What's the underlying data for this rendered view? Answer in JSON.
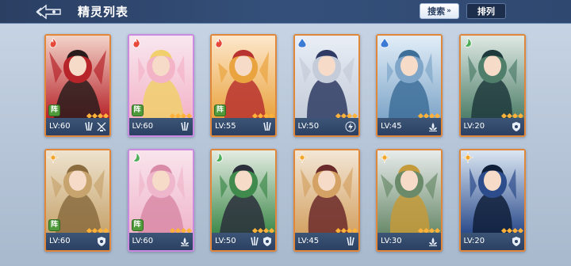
{
  "header": {
    "title": "精灵列表",
    "search_label": "搜索",
    "sort_label": "排列"
  },
  "colors": {
    "header_bg": "#2b3f63",
    "card_border_orange": "#e0873a",
    "card_border_purple": "#c98ae0",
    "card_footer": "#2f4568",
    "formation_badge": "#4f9a3a"
  },
  "cards": [
    {
      "level": "LV:60",
      "element": "fire-icon",
      "formation": "阵",
      "roles": [
        "claw-icon",
        "sword-scale-icon"
      ],
      "palette": [
        "#f2d3c9",
        "#b7242a",
        "#2a1c1c"
      ]
    },
    {
      "level": "LV:60",
      "element": "fire-icon",
      "formation": "阵",
      "roles": [
        "claw-icon"
      ],
      "palette": [
        "#f8e7ef",
        "#f3b4c8",
        "#f0cf6c"
      ]
    },
    {
      "level": "LV:55",
      "element": "fire-icon",
      "formation": "阵",
      "roles": [
        "claw-icon"
      ],
      "palette": [
        "#fde7cc",
        "#e9a43f",
        "#b8322f"
      ]
    },
    {
      "level": "LV:50",
      "element": "water-icon",
      "formation": "",
      "roles": [
        "lightning-icon"
      ],
      "palette": [
        "#e9eef6",
        "#c4ccd9",
        "#2e3a63"
      ]
    },
    {
      "level": "LV:45",
      "element": "water-icon",
      "formation": "",
      "roles": [
        "lotus-icon"
      ],
      "palette": [
        "#e2eef8",
        "#7fa6c9",
        "#3d6f99"
      ]
    },
    {
      "level": "LV:20",
      "element": "wind-icon",
      "formation": "",
      "roles": [
        "shield-icon"
      ],
      "palette": [
        "#dfe9e4",
        "#4f7f6a",
        "#1f3a3c"
      ]
    },
    {
      "level": "LV:60",
      "element": "light-icon",
      "formation": "阵",
      "roles": [
        "shield-icon"
      ],
      "palette": [
        "#eee3cf",
        "#c7a46d",
        "#8a6c3f"
      ]
    },
    {
      "level": "LV:60",
      "element": "wind-icon",
      "formation": "阵",
      "roles": [
        "lotus-icon"
      ],
      "palette": [
        "#f9e4ec",
        "#efb7cb",
        "#d98aa6"
      ]
    },
    {
      "level": "LV:50",
      "element": "wind-icon",
      "formation": "",
      "roles": [
        "claw-icon",
        "shield-icon"
      ],
      "palette": [
        "#e4ece2",
        "#3f8a4c",
        "#2a2f3b"
      ]
    },
    {
      "level": "LV:45",
      "element": "light-icon",
      "formation": "",
      "roles": [
        "claw-icon"
      ],
      "palette": [
        "#f2e6d5",
        "#d4a264",
        "#6b2a2a"
      ]
    },
    {
      "level": "LV:30",
      "element": "light-icon",
      "formation": "",
      "roles": [
        "lotus-icon"
      ],
      "palette": [
        "#e8ecec",
        "#6a8a6a",
        "#c49a3a"
      ]
    },
    {
      "level": "LV:20",
      "element": "light-icon",
      "formation": "",
      "roles": [
        "shield-icon"
      ],
      "palette": [
        "#dbe6f2",
        "#2c4c8c",
        "#0f1f3a"
      ]
    }
  ]
}
